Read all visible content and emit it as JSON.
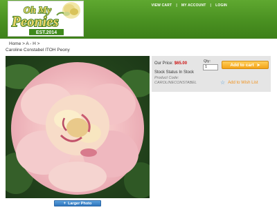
{
  "logo": {
    "line1": "Oh My",
    "line2": "Peonies",
    "line3": "EST.2014"
  },
  "top_nav": {
    "view_cart": "VIEW CART",
    "my_account": "MY ACCOUNT",
    "login": "LOGIN",
    "separator": "|"
  },
  "breadcrumb": "Home > A - H >",
  "product": {
    "title": "Caroline Constabel ITOH Peony",
    "price_label": "Our Price:",
    "price": "$65.00",
    "qty_label": "Qty:",
    "qty_value": "1",
    "add_to_cart": "Add to cart",
    "stock_status": "Stock Status In Stock",
    "code_label": "Product Code:",
    "code_value": "CAROLINECONSTABEL",
    "wishlist": "Add to Wish List",
    "larger_photo": "Larger Photo"
  },
  "colors": {
    "header_green": "#4b9222",
    "price_red": "#cc1111",
    "cart_orange": "#f5a418",
    "wishlist_orange": "#f0901a",
    "button_blue": "#2e74bd"
  },
  "icons": {
    "cart_arrow": "arrow-right-icon",
    "wishlist": "star-icon",
    "larger": "plus-icon"
  }
}
